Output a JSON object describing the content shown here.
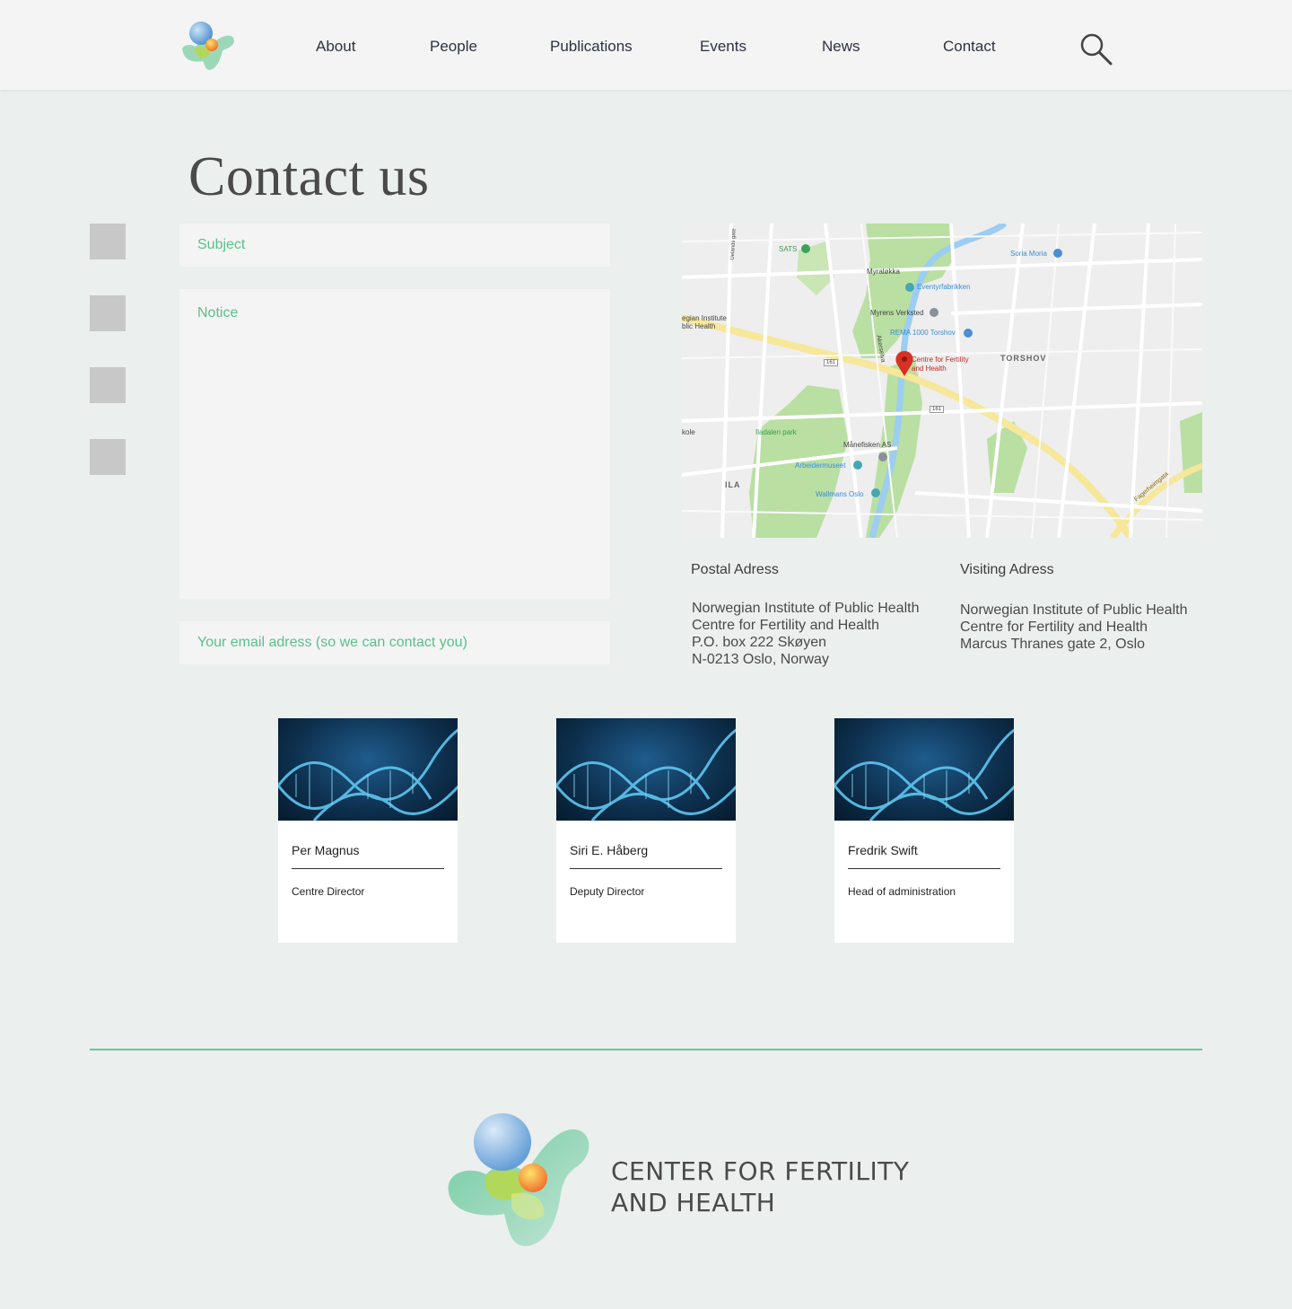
{
  "nav": {
    "about": "About",
    "people": "People",
    "publications": "Publications",
    "events": "Events",
    "news": "News",
    "contact": "Contact",
    "search_icon": "search-icon"
  },
  "page": {
    "title": "Contact us"
  },
  "form": {
    "subject_placeholder": "Subject",
    "notice_placeholder": "Notice",
    "email_placeholder": "Your email adress (so we can contact you)"
  },
  "map": {
    "labels": {
      "sats": "SATS",
      "soria_moria": "Soria Moria",
      "myralokka": "Myraløkka",
      "eventyrfabrikken": "Eventyrfabrikken",
      "myrens_verksted": "Myrens Verksted",
      "rema": "REMA 1000 Torshov",
      "torshov": "TORSHOV",
      "centre_line1": "Centre for Fertility",
      "centre_line2": "and Health",
      "institute_line1": "egian Institute",
      "institute_line2": "blic Health",
      "iladalen": "Iladalen park",
      "manefisken": "Månefisken AS",
      "arbeidermuseet": "Arbeidermuseet",
      "wallmans": "Wallmans Oslo",
      "ila": "ILA",
      "kole": "kole",
      "road_161a": "161",
      "road_161b": "161",
      "akerselva": "Akerselva",
      "fagerheimgata": "Fagerheimgata",
      "uelands": "Uelands gate"
    }
  },
  "postal": {
    "heading": "Postal Adress",
    "lines": [
      "Norwegian Institute of Public Health",
      "Centre for Fertility and Health",
      "P.O. box 222 Skøyen",
      "N-0213 Oslo, Norway"
    ]
  },
  "visiting": {
    "heading": "Visiting Adress",
    "lines": [
      "Norwegian Institute of Public Health",
      "Centre for Fertility and Health",
      "Marcus Thranes gate 2, Oslo"
    ]
  },
  "people": [
    {
      "name": "Per Magnus",
      "role": "Centre Director"
    },
    {
      "name": "Siri E. Håberg",
      "role": "Deputy Director"
    },
    {
      "name": "Fredrik Swift",
      "role": "Head of administration"
    }
  ],
  "footer": {
    "line1": "CENTER FOR FERTILITY",
    "line2": "AND HEALTH"
  },
  "colors": {
    "accent_green": "#5bbf8a",
    "footer_line": "#6cc49a",
    "background": "#ebefed",
    "nav_text": "#2d3142"
  }
}
